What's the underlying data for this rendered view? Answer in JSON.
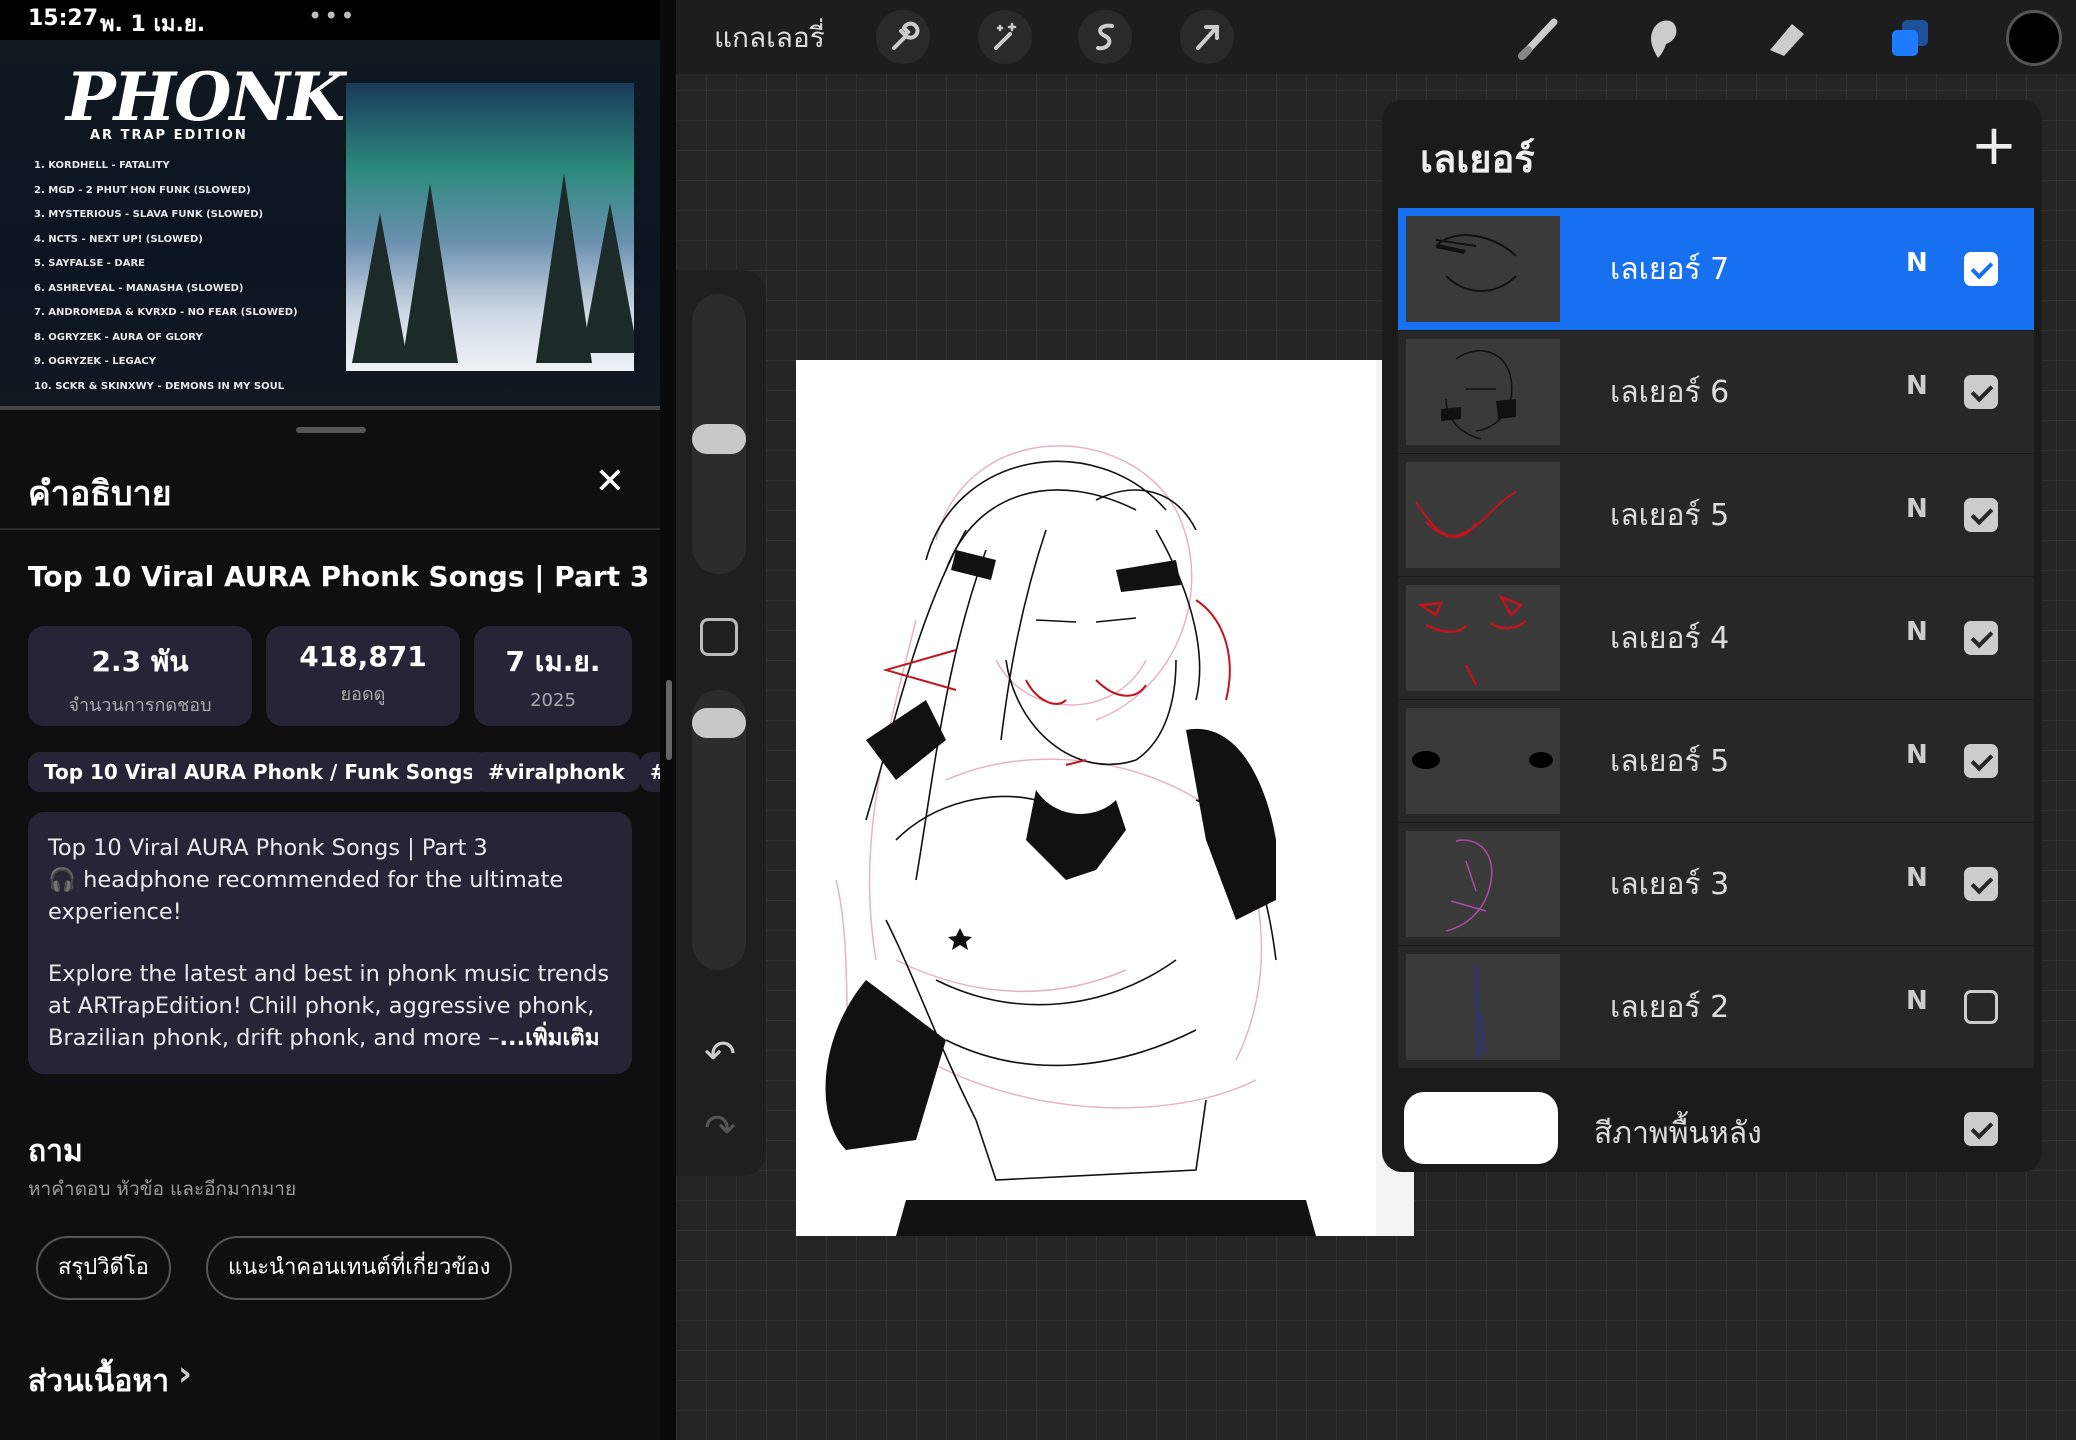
{
  "status_bar": {
    "time": "15:27",
    "date": "พ. 1 เม.ย.",
    "dots": "•••"
  },
  "video": {
    "logo": "PHONK",
    "logo_sub": "AR TRAP EDITION",
    "tracks": [
      "1. KORDHELL - FATALITY",
      "2. MGD - 2 PHUT HON FUNK (SLOWED)",
      "3. MYSTERIOUS - SLAVA FUNK (SLOWED)",
      "4. NCTS - NEXT UP! (SLOWED)",
      "5. SAYFALSE - DARE",
      "6. ASHREVEAL - MANASHA (SLOWED)",
      "7. ANDROMEDA & KVRXD - NO FEAR (SLOWED)",
      "8. OGRYZEK - AURA OF GLORY",
      "9. OGRYZEK - LEGACY",
      "10. SCKR & SKINXWY - DEMONS IN MY SOUL"
    ]
  },
  "description": {
    "header": "คำอธิบาย",
    "close_icon": "close-icon",
    "title": "Top 10 Viral AURA Phonk Songs | Part 3",
    "stats": {
      "likes_value": "2.3 พัน",
      "likes_label": "จำนวนการกดชอบ",
      "views_value": "418,871",
      "views_label": "ยอดดู",
      "date_value": "7 เม.ย.",
      "date_year": "2025"
    },
    "chips": [
      "Top 10 Viral AURA Phonk / Funk Songs",
      "#viralphonk",
      "#"
    ],
    "body_line1": "Top 10 Viral AURA Phonk Songs | Part 3",
    "body_line2": "🎧 headphone recommended for the ultimate experience!",
    "body_para2": "Explore the latest and best in phonk music trends at ARTrapEdition! Chill phonk, aggressive phonk, Brazilian phonk, drift phonk, and more –",
    "more_label": "...เพิ่มเติม"
  },
  "ask": {
    "title": "ถาม",
    "subtitle": "หาคำตอบ หัวข้อ และอีกมากมาย",
    "pills": [
      "สรุปวิดีโอ",
      "แนะนำคอนเทนต์ที่เกี่ยวข้อง"
    ]
  },
  "sections_link": "ส่วนเนื้อหา",
  "procreate": {
    "gallery": "แกลเลอรี่",
    "layers_title": "เลเยอร์",
    "layers": [
      {
        "name": "เลเยอร์ 7",
        "mode": "N",
        "visible": true,
        "selected": true
      },
      {
        "name": "เลเยอร์ 6",
        "mode": "N",
        "visible": true,
        "selected": false
      },
      {
        "name": "เลเยอร์ 5",
        "mode": "N",
        "visible": true,
        "selected": false
      },
      {
        "name": "เลเยอร์ 4",
        "mode": "N",
        "visible": true,
        "selected": false
      },
      {
        "name": "เลเยอร์ 5",
        "mode": "N",
        "visible": true,
        "selected": false
      },
      {
        "name": "เลเยอร์ 3",
        "mode": "N",
        "visible": true,
        "selected": false
      },
      {
        "name": "เลเยอร์ 2",
        "mode": "N",
        "visible": false,
        "selected": false
      }
    ],
    "background_layer": "สีภาพพื้นหลัง",
    "accent_color": "#1670f0",
    "current_color": "#000000"
  }
}
